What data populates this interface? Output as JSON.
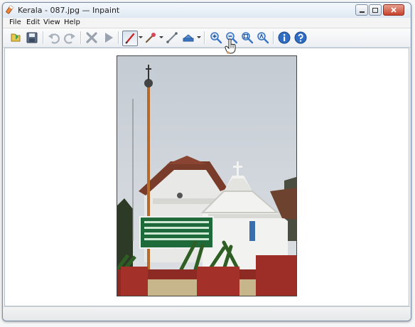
{
  "window": {
    "title": "Kerala - 087.jpg — Inpaint"
  },
  "menu": {
    "items": [
      "File",
      "Edit",
      "View",
      "Help"
    ]
  },
  "toolbar": {
    "buttons": [
      "open",
      "save",
      "undo",
      "redo",
      "erase",
      "run",
      "marker",
      "magic-wand",
      "line",
      "stamp",
      "zoom-in",
      "zoom-out",
      "zoom-fit",
      "zoom-actual",
      "info",
      "help"
    ]
  },
  "canvas": {
    "sign_text": "",
    "photo_subject": "church"
  },
  "colors": {
    "accent": "#3a75c4",
    "titlebar": "#dfe8f2",
    "close": "#c7412b"
  },
  "statusbar": {
    "text": ""
  }
}
